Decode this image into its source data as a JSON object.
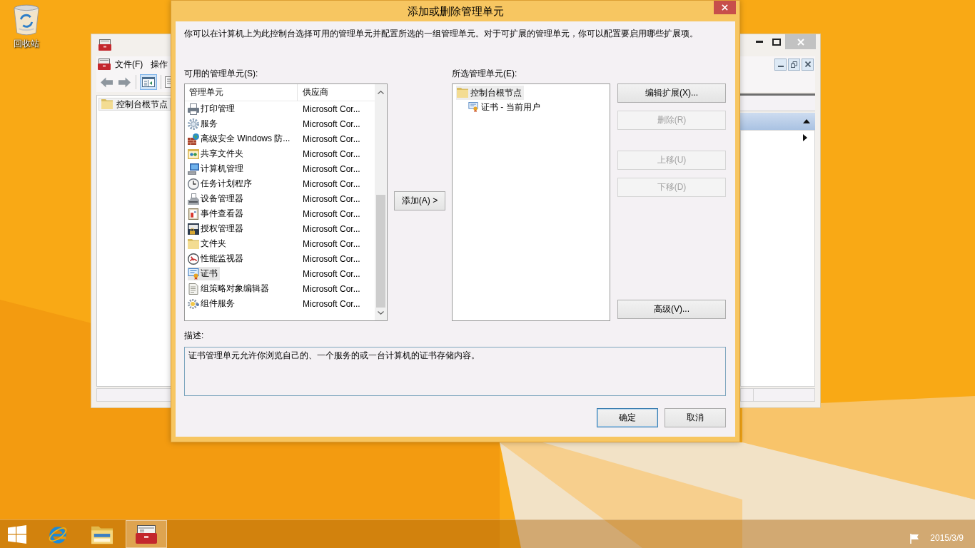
{
  "desktop": {
    "icons": [
      {
        "label": "回收站"
      }
    ]
  },
  "background_window": {
    "menu": [
      {
        "label": "文件(F)"
      },
      {
        "label": "操作"
      }
    ],
    "tree": [
      {
        "label": "控制台根节点",
        "selected": true
      }
    ]
  },
  "dialog": {
    "title": "添加或删除管理单元",
    "intro": "你可以在计算机上为此控制台选择可用的管理单元并配置所选的一组管理单元。对于可扩展的管理单元，你可以配置要启用哪些扩展项。",
    "available": {
      "label": "可用的管理单元(S):",
      "columns": [
        "管理单元",
        "供应商"
      ],
      "rows": [
        {
          "name": "打印管理",
          "vendor": "Microsoft Cor...",
          "selected": false
        },
        {
          "name": "服务",
          "vendor": "Microsoft Cor...",
          "selected": false
        },
        {
          "name": "高级安全 Windows 防...",
          "vendor": "Microsoft Cor...",
          "selected": false
        },
        {
          "name": "共享文件夹",
          "vendor": "Microsoft Cor...",
          "selected": false
        },
        {
          "name": "计算机管理",
          "vendor": "Microsoft Cor...",
          "selected": false
        },
        {
          "name": "任务计划程序",
          "vendor": "Microsoft Cor...",
          "selected": false
        },
        {
          "name": "设备管理器",
          "vendor": "Microsoft Cor...",
          "selected": false
        },
        {
          "name": "事件查看器",
          "vendor": "Microsoft Cor...",
          "selected": false
        },
        {
          "name": "授权管理器",
          "vendor": "Microsoft Cor...",
          "selected": false
        },
        {
          "name": "文件夹",
          "vendor": "Microsoft Cor...",
          "selected": false
        },
        {
          "name": "性能监视器",
          "vendor": "Microsoft Cor...",
          "selected": false
        },
        {
          "name": "证书",
          "vendor": "Microsoft Cor...",
          "selected": true
        },
        {
          "name": "组策略对象编辑器",
          "vendor": "Microsoft Cor...",
          "selected": false
        },
        {
          "name": "组件服务",
          "vendor": "Microsoft Cor...",
          "selected": false
        }
      ]
    },
    "add_button": "添加(A) >",
    "selected_snapins": {
      "label": "所选管理单元(E):",
      "tree": [
        {
          "label": "控制台根节点",
          "selected": true,
          "children": [
            {
              "label": "证书 - 当前用户",
              "selected": false
            }
          ]
        }
      ]
    },
    "side_buttons": [
      {
        "label": "编辑扩展(X)...",
        "disabled": false
      },
      {
        "label": "删除(R)",
        "disabled": true
      },
      {
        "label": "上移(U)",
        "disabled": true
      },
      {
        "label": "下移(D)",
        "disabled": true
      },
      {
        "label": "高级(V)...",
        "disabled": false
      }
    ],
    "description": {
      "label": "描述:",
      "text": "证书管理单元允许你浏览自己的、一个服务的或一台计算机的证书存储内容。"
    },
    "buttons": [
      {
        "label": "确定",
        "default": true
      },
      {
        "label": "取消",
        "default": false
      }
    ]
  },
  "taskbar": {
    "apps": [
      {
        "active": false
      },
      {
        "active": false
      },
      {
        "active": true
      }
    ],
    "date": "2015/3/9"
  }
}
